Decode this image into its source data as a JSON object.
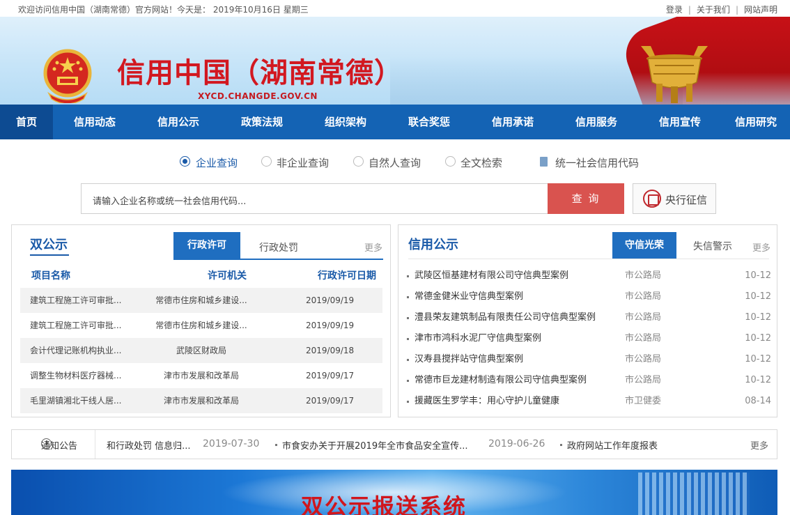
{
  "topbar": {
    "welcome": "欢迎访问信用中国（湖南常德）官方网站！今天是： 2019年10月16日 星期三",
    "links": [
      "登录",
      "关于我们",
      "网站声明"
    ]
  },
  "header": {
    "title": "信用中国（湖南常德）",
    "domain": "XYCD.CHANGDE.GOV.CN"
  },
  "nav": {
    "items": [
      "首页",
      "信用动态",
      "信用公示",
      "政策法规",
      "组织架构",
      "联合奖惩",
      "信用承诺",
      "信用服务",
      "信用宣传",
      "信用研究"
    ],
    "active_index": 0
  },
  "search": {
    "tabs": [
      "企业查询",
      "非企业查询",
      "自然人查询",
      "全文检索"
    ],
    "selected_index": 0,
    "code_link": "统一社会信用代码",
    "placeholder": "请输入企业名称或统一社会信用代码...",
    "button": "查 询",
    "pbc_button": "央行征信"
  },
  "dual_disclosure": {
    "title": "双公示",
    "tabs": [
      "行政许可",
      "行政处罚"
    ],
    "active_tab": 0,
    "more": "更多",
    "columns": [
      "项目名称",
      "许可机关",
      "行政许可日期"
    ],
    "rows": [
      [
        "建筑工程施工许可审批...",
        "常德市住房和城乡建设...",
        "2019/09/19"
      ],
      [
        "建筑工程施工许可审批...",
        "常德市住房和城乡建设...",
        "2019/09/19"
      ],
      [
        "会计代理记账机构执业...",
        "武陵区财政局",
        "2019/09/18"
      ],
      [
        "调整生物材料医疗器械...",
        "津市市发展和改革局",
        "2019/09/17"
      ],
      [
        "毛里湖镇湘北干线人居...",
        "津市市发展和改革局",
        "2019/09/17"
      ]
    ]
  },
  "credit_disclosure": {
    "title": "信用公示",
    "tabs": [
      "守信光荣",
      "失信警示"
    ],
    "active_tab": 0,
    "more": "更多",
    "items": [
      {
        "title": "武陵区恒基建材有限公司守信典型案例",
        "dept": "市公路局",
        "date": "10-12"
      },
      {
        "title": "常德金健米业守信典型案例",
        "dept": "市公路局",
        "date": "10-12"
      },
      {
        "title": "澧县荣友建筑制品有限责任公司守信典型案例",
        "dept": "市公路局",
        "date": "10-12"
      },
      {
        "title": "津市市鸿科水泥厂守信典型案例",
        "dept": "市公路局",
        "date": "10-12"
      },
      {
        "title": "汉寿县搅拌站守信典型案例",
        "dept": "市公路局",
        "date": "10-12"
      },
      {
        "title": "常德市巨龙建材制造有限公司守信典型案例",
        "dept": "市公路局",
        "date": "10-12"
      },
      {
        "title": "援藏医生罗学丰：用心守护儿童健康",
        "dept": "市卫健委",
        "date": "08-14"
      }
    ]
  },
  "notice": {
    "title": "通知公告",
    "items": [
      {
        "text": "和行政处罚 信息归...",
        "date": "2019-07-30"
      },
      {
        "text": "市食安办关于开展2019年全市食品安全宣传...",
        "date": "2019-06-26"
      },
      {
        "text": "政府网站工作年度报表",
        "date": ""
      }
    ],
    "more": "更多"
  },
  "bottom_banner": {
    "title": "双公示报送系统"
  },
  "colors": {
    "nav_bg": "#1463b4",
    "nav_active": "#0d4b92",
    "title_red": "#d21820",
    "accent_blue": "#1a5aa8",
    "search_button": "#d9534f"
  }
}
